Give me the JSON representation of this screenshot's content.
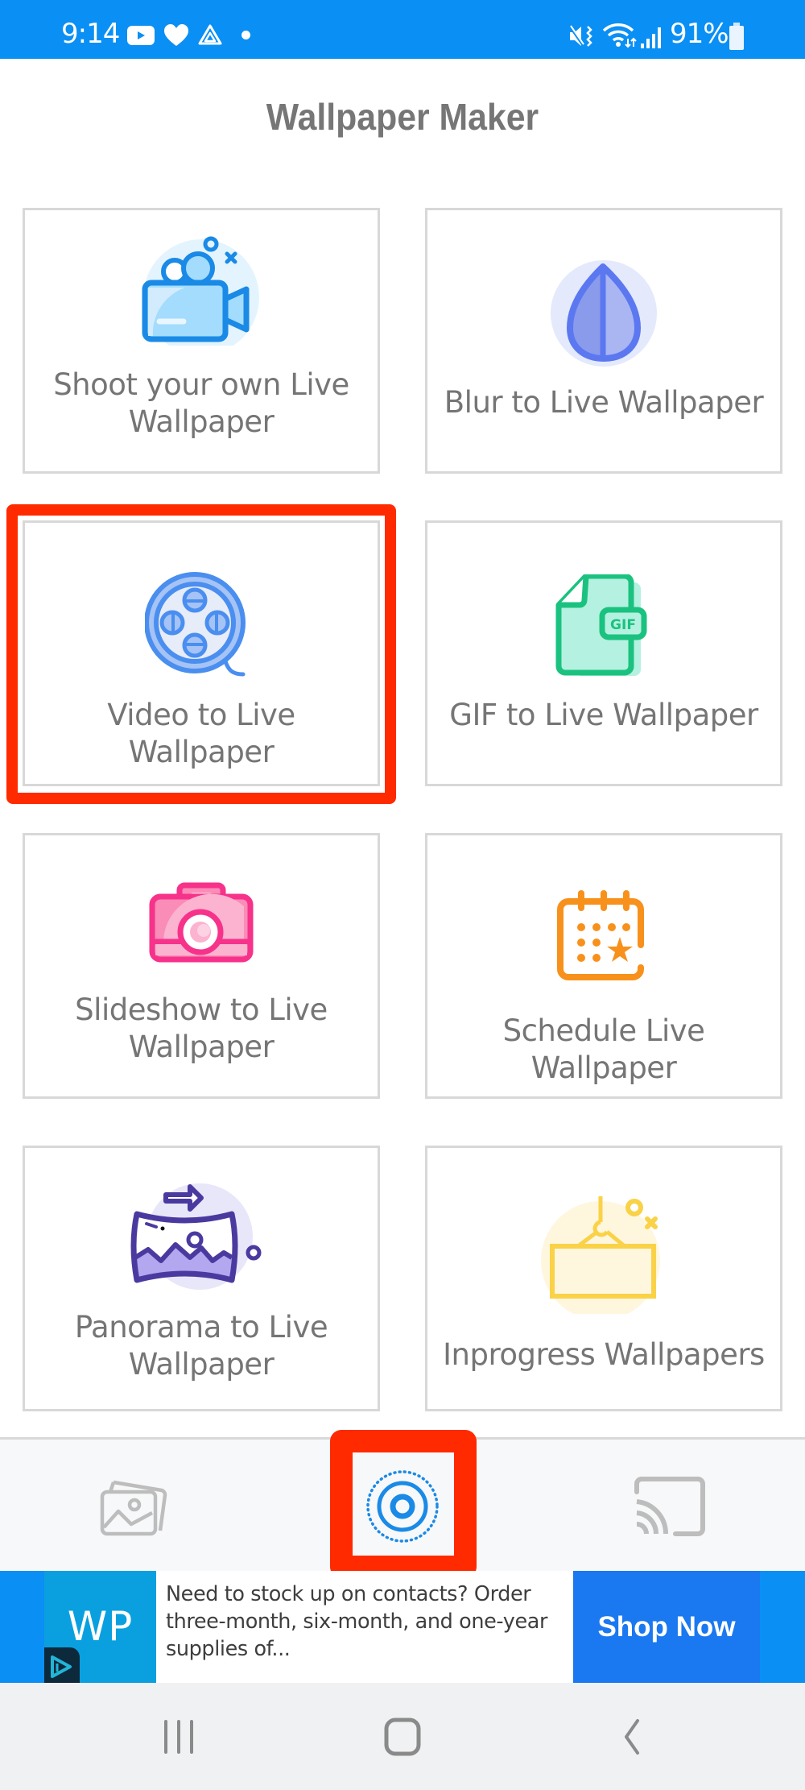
{
  "status_bar": {
    "time": "9:14",
    "notification_icons": [
      "youtube-icon",
      "heart-icon",
      "drive-icon",
      "dot-icon"
    ],
    "system_icons": [
      "mute-vibrate-icon",
      "wifi-icon",
      "signal-icon",
      "battery-icon"
    ],
    "battery": "91%"
  },
  "header": {
    "title": "Wallpaper Maker"
  },
  "cards": [
    {
      "label_line1": "Shoot your own Live",
      "label_line2": "Wallpaper",
      "icon": "video-camera-icon"
    },
    {
      "label": "Blur to Live Wallpaper",
      "icon": "blur-drop-icon"
    },
    {
      "label": "Video to Live Wallpaper",
      "icon": "film-reel-icon",
      "highlighted": true
    },
    {
      "label": "GIF to Live Wallpaper",
      "icon": "gif-file-icon",
      "badge": "GIF"
    },
    {
      "label_line1": "Slideshow to Live",
      "label_line2": "Wallpaper",
      "icon": "camera-icon"
    },
    {
      "label": "Schedule Live Wallpaper",
      "icon": "calendar-star-icon"
    },
    {
      "label_line1": "Panorama to Live",
      "label_line2": "Wallpaper",
      "icon": "panorama-icon"
    },
    {
      "label": "Inprogress Wallpapers",
      "icon": "hanging-sign-icon"
    }
  ],
  "tab_bar": {
    "tabs": [
      {
        "name": "gallery",
        "icon": "gallery-icon",
        "active": false
      },
      {
        "name": "create",
        "icon": "live-target-icon",
        "active": true
      },
      {
        "name": "cast",
        "icon": "cast-icon",
        "active": false
      }
    ]
  },
  "ad": {
    "logo_text": "WP",
    "text": "Need to stock up on contacts? Order three-month, six-month, and one-year supplies of...",
    "cta": "Shop Now"
  },
  "system_nav": {
    "buttons": [
      "recents",
      "home",
      "back"
    ]
  },
  "colors": {
    "status_bar": "#0a8ff5",
    "highlight": "#ff2a00",
    "accent_blue": "#1a8ae6",
    "cta": "#1a78f0"
  }
}
